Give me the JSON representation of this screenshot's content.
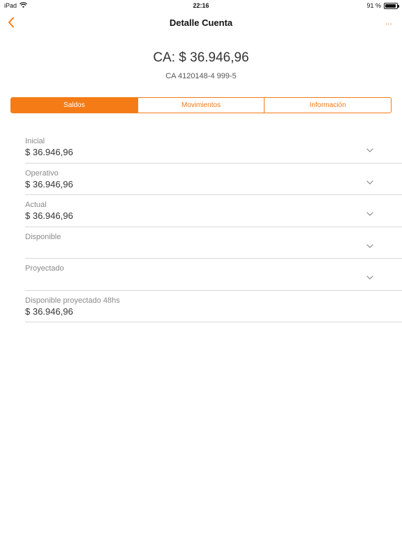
{
  "status_bar": {
    "device": "iPad",
    "time": "22:16",
    "battery": "91 %",
    "battery_level": 0.91
  },
  "nav": {
    "title": "Detalle Cuenta",
    "more_label": "..."
  },
  "account": {
    "balance": "CA: $ 36.946,96",
    "number": "CA 4120148-4 999-5"
  },
  "tabs": [
    {
      "label": "Saldos",
      "active": true
    },
    {
      "label": "Movimientos",
      "active": false
    },
    {
      "label": "Información",
      "active": false
    }
  ],
  "balances": [
    {
      "label": "Inicial",
      "value": "$ 36.946,96",
      "expandable": true
    },
    {
      "label": "Operativo",
      "value": "$ 36.946,96",
      "expandable": true
    },
    {
      "label": "Actual",
      "value": "$ 36.946,96",
      "expandable": true
    },
    {
      "label": "Disponible",
      "value": "",
      "expandable": true
    },
    {
      "label": "Proyectado",
      "value": "",
      "expandable": true
    },
    {
      "label": "Disponible proyectado 48hs",
      "value": "$ 36.946,96",
      "expandable": false
    }
  ],
  "colors": {
    "accent": "#f47b16",
    "label": "#8a8a8a",
    "divider": "#d8d8d8"
  },
  "icons": {
    "back": "chevron-left-icon",
    "wifi": "wifi-icon",
    "battery": "battery-icon",
    "row_expand": "chevron-down-icon"
  }
}
